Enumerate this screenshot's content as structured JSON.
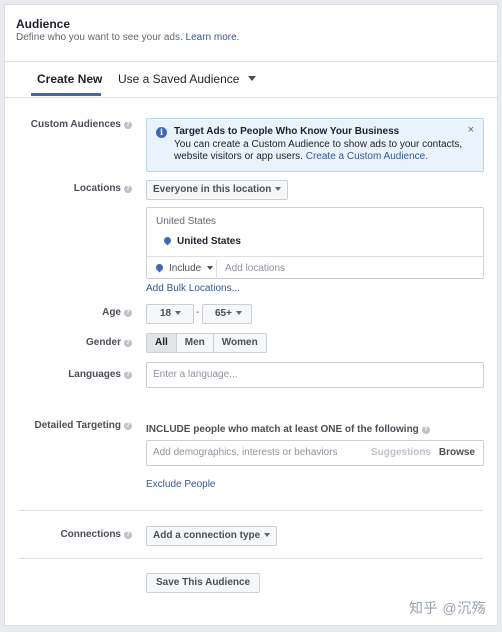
{
  "header": {
    "title": "Audience",
    "subtitle": "Define who you want to see your ads.",
    "learn_more": "Learn more."
  },
  "tabs": [
    {
      "label": "Create New",
      "active": true
    },
    {
      "label": "Use a Saved Audience",
      "active": false
    }
  ],
  "custom_audiences": {
    "label": "Custom Audiences",
    "info_title": "Target Ads to People Who Know Your Business",
    "info_body": "You can create a Custom Audience to show ads to your contacts, website visitors or app users.",
    "info_link": "Create a Custom Audience.",
    "close": "×"
  },
  "locations": {
    "label": "Locations",
    "dropdown": "Everyone in this location",
    "country_header": "United States",
    "selected": "United States",
    "include": "Include",
    "add_placeholder": "Add locations",
    "bulk_link": "Add Bulk Locations..."
  },
  "age": {
    "label": "Age",
    "min": "18",
    "max": "65+",
    "separator": "-"
  },
  "gender": {
    "label": "Gender",
    "options": [
      "All",
      "Men",
      "Women"
    ],
    "selected": "All"
  },
  "languages": {
    "label": "Languages",
    "placeholder": "Enter a language..."
  },
  "detailed_targeting": {
    "label": "Detailed Targeting",
    "heading": "INCLUDE people who match at least ONE of the following",
    "placeholder": "Add demographics, interests or behaviors",
    "suggestions": "Suggestions",
    "browse": "Browse",
    "exclude_link": "Exclude People"
  },
  "connections": {
    "label": "Connections",
    "dropdown": "Add a connection type"
  },
  "save_button": "Save This Audience",
  "watermark": "知乎 @沉殇",
  "colors": {
    "link": "#365899",
    "accent": "#4267b2",
    "info_bg": "#eaf2fb"
  }
}
